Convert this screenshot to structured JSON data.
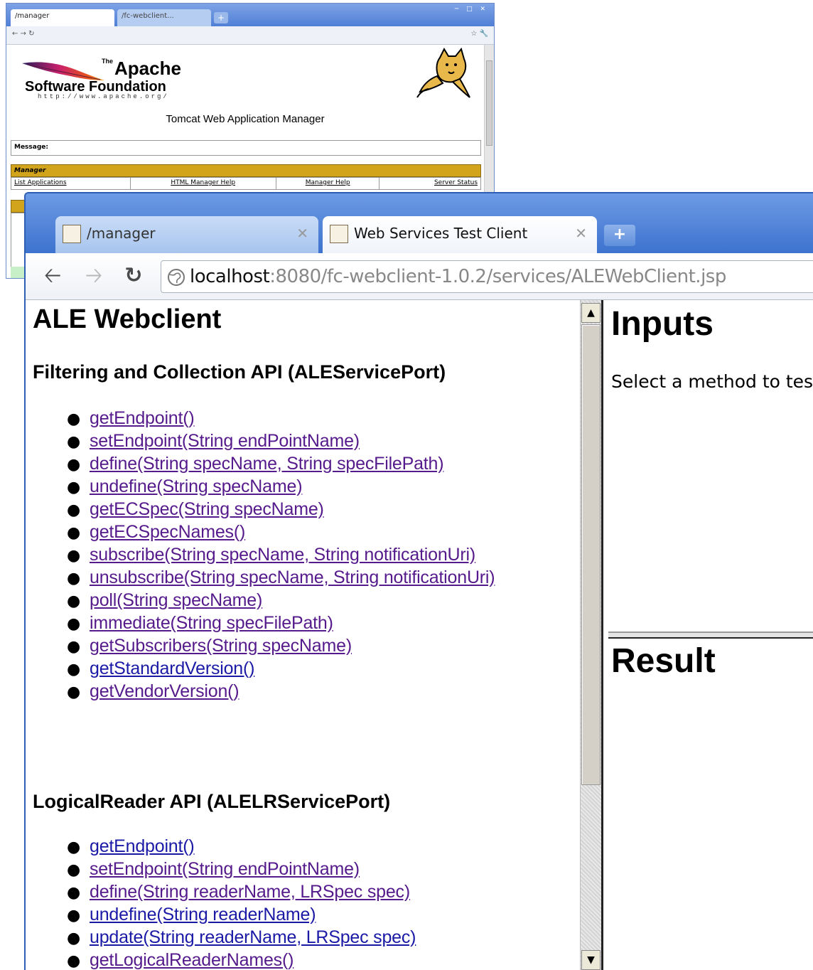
{
  "background_window": {
    "tabs": [
      "/manager",
      "/fc-webclient..."
    ],
    "logo": {
      "the": "The",
      "apache": "Apache",
      "software_foundation": "Software Foundation",
      "url": "http://www.apache.org/"
    },
    "heading": "Tomcat Web Application Manager",
    "message_label": "Message:",
    "manager_label": "Manager",
    "links": [
      "List Applications",
      "HTML Manager Help",
      "Manager Help",
      "Server Status"
    ]
  },
  "browser": {
    "tabs": [
      {
        "label": "/manager",
        "active": false
      },
      {
        "label": "Web Services Test Client",
        "active": true
      }
    ],
    "new_tab_label": "+",
    "url_host": "localhost",
    "url_rest": ":8080/fc-webclient-1.0.2/services/ALEWebClient.jsp"
  },
  "left_frame": {
    "title": "ALE Webclient",
    "ale_section": {
      "title": "Filtering and Collection API (ALEServicePort)",
      "methods": [
        "getEndpoint()",
        "setEndpoint(String endPointName)",
        "define(String specName, String specFilePath)",
        "undefine(String specName)",
        "getECSpec(String specName)",
        "getECSpecNames()",
        "subscribe(String specName, String notificationUri)",
        "unsubscribe(String specName, String notificationUri)",
        "poll(String specName)",
        "immediate(String specFilePath)",
        "getSubscribers(String specName)",
        "getStandardVersion()",
        "getVendorVersion()"
      ]
    },
    "lr_section": {
      "title": "LogicalReader API (ALELRServicePort)",
      "methods": [
        "getEndpoint()",
        "setEndpoint(String endPointName)",
        "define(String readerName, LRSpec spec)",
        "undefine(String readerName)",
        "update(String readerName, LRSpec spec)",
        "getLogicalReaderNames()"
      ]
    }
  },
  "inputs_frame": {
    "title": "Inputs",
    "hint": "Select a method to test."
  },
  "result_frame": {
    "title": "Result"
  },
  "colors": {
    "visited_link": "#551a8b",
    "unvisited_link": "#1a1aa6",
    "titlebar": "#4a82d8",
    "manager_bar": "#d2a41c"
  }
}
